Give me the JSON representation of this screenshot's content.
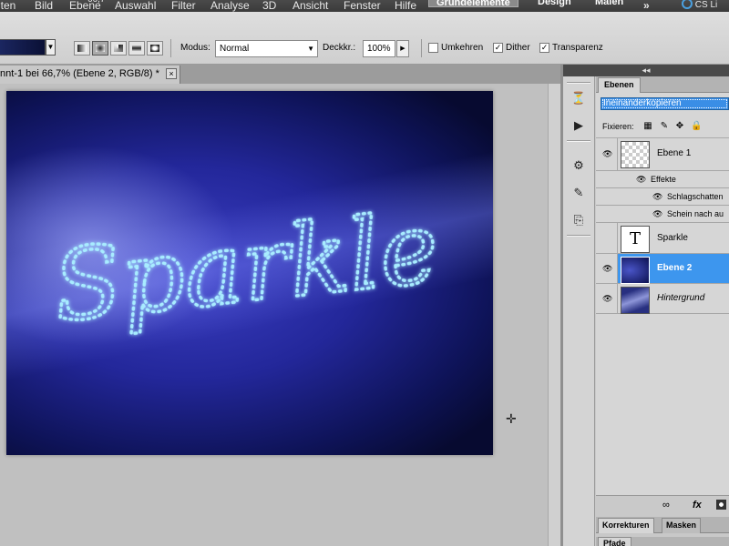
{
  "menubar": {
    "items": [
      "iten",
      "Bild",
      "Ebene",
      "Auswahl",
      "Filter",
      "Analyse",
      "3D",
      "Ansicht",
      "Fenster",
      "Hilfe"
    ],
    "zoom_partial": "66,7",
    "workspaces": [
      "Grundelemente",
      "Design",
      "Malen"
    ],
    "more_label": "»",
    "cs_live_label": "CS Li"
  },
  "options": {
    "modus_label": "Modus:",
    "modus_value": "Normal",
    "opacity_label": "Deckkr.:",
    "opacity_value": "100%",
    "umkehren_label": "Umkehren",
    "umkehren_checked": false,
    "dither_label": "Dither",
    "dither_checked": true,
    "transparenz_label": "Transparenz",
    "transparenz_checked": true,
    "gradient_color": "#1b2660"
  },
  "document": {
    "tab_title": "nnt-1 bei 66,7% (Ebene 2, RGB/8) *",
    "close_glyph": "×"
  },
  "canvas": {
    "artwork_text": "Sparkle"
  },
  "dock": {
    "collapse_glyph": "◂◂"
  },
  "layers_panel": {
    "tab": "Ebenen",
    "blend_mode": "Ineinanderkopieren",
    "lock_label": "Fixieren:",
    "layers": [
      {
        "name": "Ebene 1",
        "visible": true
      },
      {
        "name": "Sparkle",
        "visible": false,
        "thumb": "T"
      },
      {
        "name": "Ebene 2",
        "visible": true,
        "selected": true
      },
      {
        "name": "Hintergrund",
        "visible": true,
        "italic": true
      }
    ],
    "effects": {
      "label": "Effekte",
      "items": [
        "Schlagschatten",
        "Schein nach au"
      ]
    },
    "bottom_icons": [
      "link-icon",
      "fx-icon",
      "mask-icon"
    ],
    "fx_label": "fx"
  },
  "lower_panels": {
    "tabs": [
      "Korrekturen",
      "Masken"
    ],
    "next_tab": "Pfade"
  }
}
